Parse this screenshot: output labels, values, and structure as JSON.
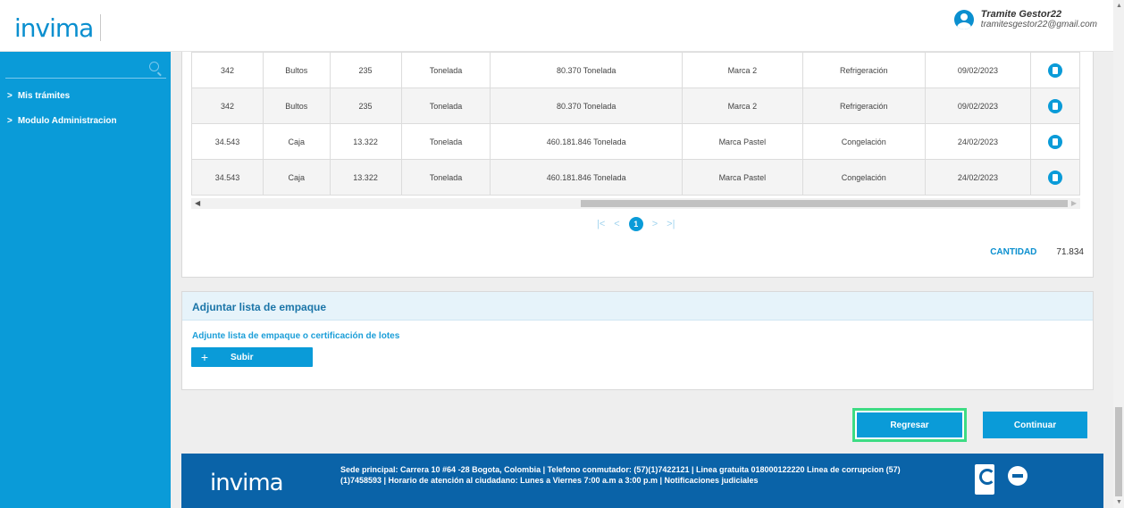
{
  "header": {
    "logo": "invima",
    "user_name": "Tramite Gestor22",
    "user_email": "tramitesgestor22@gmail.com"
  },
  "sidebar": {
    "items": [
      {
        "label": "Mis trámites"
      },
      {
        "label": "Modulo Administracion"
      }
    ]
  },
  "table": {
    "rows": [
      [
        "342",
        "Bultos",
        "235",
        "Tonelada",
        "80.370 Tonelada",
        "Marca 2",
        "Refrigeración",
        "09/02/2023"
      ],
      [
        "342",
        "Bultos",
        "235",
        "Tonelada",
        "80.370 Tonelada",
        "Marca 2",
        "Refrigeración",
        "09/02/2023"
      ],
      [
        "34.543",
        "Caja",
        "13.322",
        "Tonelada",
        "460.181.846 Tonelada",
        "Marca Pastel",
        "Congelación",
        "24/02/2023"
      ],
      [
        "34.543",
        "Caja",
        "13.322",
        "Tonelada",
        "460.181.846 Tonelada",
        "Marca Pastel",
        "Congelación",
        "24/02/2023"
      ]
    ]
  },
  "pager": {
    "current": "1"
  },
  "quantity": {
    "label": "CANTIDAD",
    "value": "71.834"
  },
  "attach": {
    "title": "Adjuntar lista de empaque",
    "subtitle": "Adjunte lista de empaque o certificación de lotes",
    "upload_label": "Subir"
  },
  "actions": {
    "back_label": "Regresar",
    "continue_label": "Continuar"
  },
  "footer": {
    "logo": "invima",
    "text": "Sede principal: Carrera 10 #64 -28 Bogota, Colombia | Telefono conmutador: (57)(1)7422121 | Linea gratuita 018000122220 Linea de corrupcion (57)(1)7458593 | Horario de atención al ciudadano: Lunes a Viernes 7:00 a.m a 3:00 p.m | Notificaciones judiciales"
  },
  "colors": {
    "primary": "#0a9bd8",
    "footer": "#0a63a8",
    "highlight": "#3ddc84"
  }
}
